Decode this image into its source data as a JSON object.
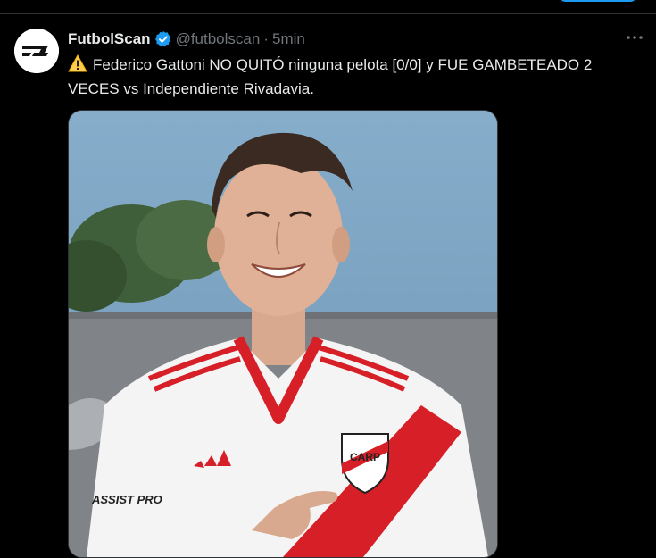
{
  "tweet": {
    "author_name": "FutbolScan",
    "handle": "@futbolscan",
    "separator": "·",
    "time": "5min",
    "text": "Federico Gattoni NO QUITÓ ninguna pelota [0/0] y FUE GAMBETEADO 2 VECES vs Independiente Rivadavia.",
    "warning_icon": "warning-icon",
    "verified_icon": "verified-badge-icon",
    "more_icon": "more-options-icon"
  },
  "media": {
    "jersey_text": "ASSIST PRO",
    "crest_text": "CARP",
    "colors": {
      "sky": "#7fa6c6",
      "shirt": "#f4f4f4",
      "stripe": "#d61f26"
    }
  },
  "colors": {
    "accent": "#1d9bf0",
    "muted": "#71767b",
    "text": "#e7e9ea"
  }
}
